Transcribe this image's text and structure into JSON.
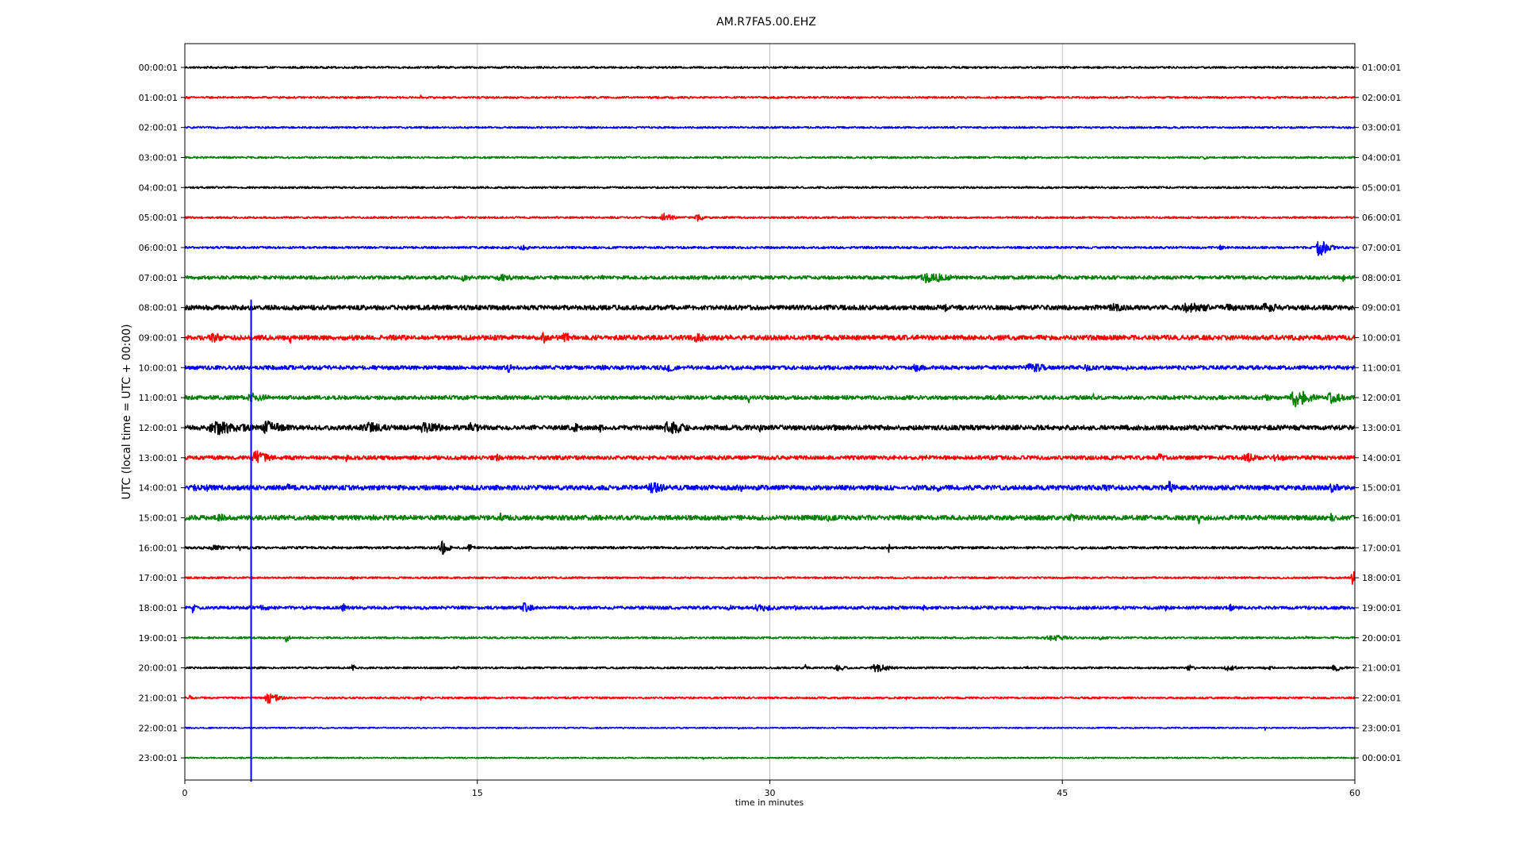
{
  "chart_data": {
    "type": "line",
    "title": "AM.R7FA5.00.EHZ",
    "xlabel": "time in minutes",
    "ylabel": "UTC (local time = UTC + 00:00)",
    "xlim": [
      0,
      60
    ],
    "xticks": [
      0,
      15,
      30,
      45,
      60
    ],
    "xtick_labels": [
      "0",
      "15",
      "30",
      "45",
      "60"
    ],
    "grid_x": true,
    "trace_colors": [
      "#000000",
      "#ff0000",
      "#0000ff",
      "#008000"
    ],
    "left_labels": [
      "00:00:01",
      "01:00:01",
      "02:00:01",
      "03:00:01",
      "04:00:01",
      "05:00:01",
      "06:00:01",
      "07:00:01",
      "08:00:01",
      "09:00:01",
      "10:00:01",
      "11:00:01",
      "12:00:01",
      "13:00:01",
      "14:00:01",
      "15:00:01",
      "16:00:01",
      "17:00:01",
      "18:00:01",
      "19:00:01",
      "20:00:01",
      "21:00:01",
      "22:00:01",
      "23:00:01"
    ],
    "right_labels": [
      "01:00:01",
      "02:00:01",
      "03:00:01",
      "04:00:01",
      "05:00:01",
      "06:00:01",
      "07:00:01",
      "08:00:01",
      "09:00:01",
      "10:00:01",
      "11:00:01",
      "12:00:01",
      "13:00:01",
      "14:00:01",
      "15:00:01",
      "16:00:01",
      "17:00:01",
      "18:00:01",
      "19:00:01",
      "20:00:01",
      "21:00:01",
      "22:00:01",
      "23:00:01",
      "00:00:01"
    ],
    "series": [
      {
        "noise": 0.12,
        "events": [
          [
            13,
            0.45,
            0.02
          ],
          [
            43.1,
            0.4,
            0.02
          ]
        ]
      },
      {
        "noise": 0.12,
        "events": [
          [
            12.1,
            0.3,
            0.02
          ],
          [
            43.9,
            0.3,
            0.02
          ]
        ]
      },
      {
        "noise": 0.12,
        "events": [
          [
            23.3,
            0.25,
            0.02
          ],
          [
            52,
            0.3,
            0.02
          ]
        ]
      },
      {
        "noise": 0.12,
        "events": [
          [
            43.1,
            0.8,
            0.02
          ],
          [
            35.2,
            0.3,
            0.02
          ],
          [
            52.3,
            0.25,
            0.1
          ]
        ]
      },
      {
        "noise": 0.12,
        "events": [
          [
            3.6,
            0.35,
            0.02
          ]
        ]
      },
      {
        "noise": 0.12,
        "events": [
          [
            10.6,
            0.35,
            0.05
          ],
          [
            24.6,
            0.55,
            0.4
          ],
          [
            26.3,
            0.6,
            0.2
          ],
          [
            32.2,
            0.4,
            0.05
          ]
        ]
      },
      {
        "noise": 0.14,
        "events": [
          [
            17.3,
            0.35,
            0.4
          ],
          [
            53.1,
            0.3,
            0.2
          ],
          [
            58.2,
            1.3,
            0.3
          ]
        ]
      },
      {
        "noise": 0.22,
        "events": [
          [
            14.3,
            0.45,
            0.5
          ],
          [
            16.3,
            0.5,
            0.6
          ],
          [
            21.4,
            0.4,
            0.05
          ],
          [
            38.2,
            0.8,
            0.8
          ],
          [
            44.8,
            0.5,
            0.1
          ],
          [
            59.4,
            0.5,
            0.1
          ]
        ]
      },
      {
        "noise": 0.3,
        "events": [
          [
            13.1,
            0.4,
            0.1
          ],
          [
            39,
            0.5,
            0.3
          ],
          [
            47.5,
            0.6,
            0.8
          ],
          [
            51.5,
            0.7,
            1
          ],
          [
            53.5,
            0.6,
            0.5
          ],
          [
            55.5,
            0.6,
            0.8
          ]
        ]
      },
      {
        "noise": 0.3,
        "events": [
          [
            1.5,
            0.6,
            0.8
          ],
          [
            5.4,
            1.1,
            0.05
          ],
          [
            18.4,
            0.8,
            0.2
          ],
          [
            19.5,
            0.9,
            0.2
          ],
          [
            26.3,
            0.6,
            0.5
          ],
          [
            57.2,
            0.5,
            0.1
          ]
        ]
      },
      {
        "noise": 0.25,
        "events": [
          [
            16.6,
            0.8,
            0.1
          ],
          [
            21.3,
            0.5,
            0.3
          ],
          [
            24.8,
            0.5,
            0.6
          ],
          [
            37.5,
            0.5,
            0.5
          ],
          [
            43.5,
            0.6,
            0.8
          ],
          [
            46.2,
            0.6,
            0.3
          ],
          [
            48.3,
            0.4,
            0.1
          ]
        ]
      },
      {
        "noise": 0.25,
        "events": [
          [
            3.5,
            0.6,
            0.8
          ],
          [
            28.9,
            1.2,
            0.03
          ],
          [
            41.8,
            0.5,
            0.1
          ],
          [
            46.6,
            1.6,
            0.03
          ],
          [
            55.5,
            0.5,
            0.3
          ],
          [
            57,
            1.3,
            0.5
          ],
          [
            58.8,
            0.8,
            0.5
          ]
        ]
      },
      {
        "noise": 0.3,
        "events": [
          [
            1.8,
            0.9,
            1.2
          ],
          [
            4.3,
            1,
            0.6
          ],
          [
            9.5,
            0.7,
            1
          ],
          [
            12.4,
            0.8,
            0.8
          ],
          [
            14.7,
            0.7,
            0.5
          ],
          [
            20,
            1,
            0.1
          ],
          [
            21.3,
            1.4,
            0.05
          ],
          [
            24.9,
            1,
            0.6
          ],
          [
            29.5,
            0.6,
            0.2
          ],
          [
            33.3,
            0.5,
            0.2
          ],
          [
            58.5,
            0.4,
            0.3
          ]
        ]
      },
      {
        "noise": 0.25,
        "events": [
          [
            3.7,
            0.9,
            0.5
          ],
          [
            8.3,
            0.5,
            0.2
          ],
          [
            16,
            0.5,
            0.2
          ],
          [
            37.9,
            0.5,
            0.2
          ],
          [
            50,
            0.5,
            0.4
          ],
          [
            54.5,
            0.6,
            0.5
          ],
          [
            56,
            0.5,
            0.5
          ]
        ]
      },
      {
        "noise": 0.3,
        "events": [
          [
            0.5,
            0.6,
            0.3
          ],
          [
            1.2,
            0.6,
            0.3
          ],
          [
            5.3,
            0.5,
            0.2
          ],
          [
            24,
            0.7,
            0.8
          ],
          [
            28.5,
            0.5,
            0.5
          ],
          [
            38.5,
            0.6,
            0.4
          ],
          [
            47.2,
            0.5,
            0.4
          ],
          [
            50.5,
            1,
            0.2
          ],
          [
            58.8,
            0.7,
            0.4
          ]
        ]
      },
      {
        "noise": 0.3,
        "events": [
          [
            1.8,
            0.5,
            0.6
          ],
          [
            9.5,
            0.5,
            0.4
          ],
          [
            16.2,
            0.6,
            0.1
          ],
          [
            33,
            0.5,
            0.5
          ],
          [
            45.5,
            0.5,
            0.4
          ],
          [
            52,
            0.9,
            0.1
          ],
          [
            58.8,
            0.6,
            0.2
          ]
        ]
      },
      {
        "noise": 0.15,
        "events": [
          [
            1.5,
            0.4,
            0.4
          ],
          [
            2.8,
            0.4,
            0.2
          ],
          [
            13.2,
            0.9,
            0.3
          ],
          [
            14.6,
            0.5,
            0.2
          ],
          [
            36.1,
            0.6,
            0.05
          ],
          [
            46,
            0.3,
            0.1
          ]
        ]
      },
      {
        "noise": 0.12,
        "events": [
          [
            8.6,
            0.3,
            0.1
          ],
          [
            39,
            0.3,
            0.05
          ],
          [
            59.9,
            1,
            0.15
          ]
        ]
      },
      {
        "noise": 0.2,
        "events": [
          [
            0.4,
            0.8,
            0.1
          ],
          [
            4,
            0.4,
            0.4
          ],
          [
            8.1,
            0.8,
            0.1
          ],
          [
            17.4,
            0.8,
            0.3
          ],
          [
            27.9,
            0.7,
            0.1
          ],
          [
            29.5,
            0.5,
            0.8
          ],
          [
            31.3,
            0.6,
            0.1
          ],
          [
            37.9,
            0.5,
            0.1
          ],
          [
            50.3,
            0.4,
            0.05
          ],
          [
            53.6,
            0.8,
            0.1
          ]
        ]
      },
      {
        "noise": 0.12,
        "events": [
          [
            5.2,
            0.8,
            0.1
          ],
          [
            17,
            0.3,
            0.05
          ],
          [
            44.5,
            0.4,
            0.8
          ],
          [
            47,
            0.3,
            0.3
          ],
          [
            57.5,
            0.3,
            0.1
          ]
        ]
      },
      {
        "noise": 0.12,
        "events": [
          [
            8.6,
            0.6,
            0.1
          ],
          [
            14,
            0.3,
            0.05
          ],
          [
            31.8,
            0.5,
            0.1
          ],
          [
            33.5,
            0.5,
            0.3
          ],
          [
            35.5,
            0.6,
            0.5
          ],
          [
            43.2,
            0.35,
            0.05
          ],
          [
            51.5,
            0.5,
            0.2
          ],
          [
            53.5,
            0.5,
            0.3
          ],
          [
            55.5,
            0.4,
            0.2
          ],
          [
            59,
            0.5,
            0.3
          ]
        ]
      },
      {
        "noise": 0.12,
        "events": [
          [
            0.2,
            0.5,
            0.1
          ],
          [
            4.3,
            1,
            0.3
          ],
          [
            12.1,
            0.3,
            0.05
          ],
          [
            37,
            0.3,
            0.05
          ],
          [
            28.5,
            0.2,
            0.05
          ]
        ]
      },
      {
        "noise": 0.08,
        "events": [
          [
            10.2,
            0.3,
            0.02
          ],
          [
            28.4,
            0.3,
            0.02
          ],
          [
            55.4,
            0.3,
            0.02
          ]
        ]
      },
      {
        "noise": 0.08,
        "events": [
          [
            26.6,
            0.2,
            0.02
          ],
          [
            39,
            0.2,
            0.02
          ]
        ]
      }
    ],
    "vertical_spike": {
      "minute": 3.4,
      "from_trace": 8,
      "to_trace": 23,
      "color": "#0000ff"
    }
  }
}
